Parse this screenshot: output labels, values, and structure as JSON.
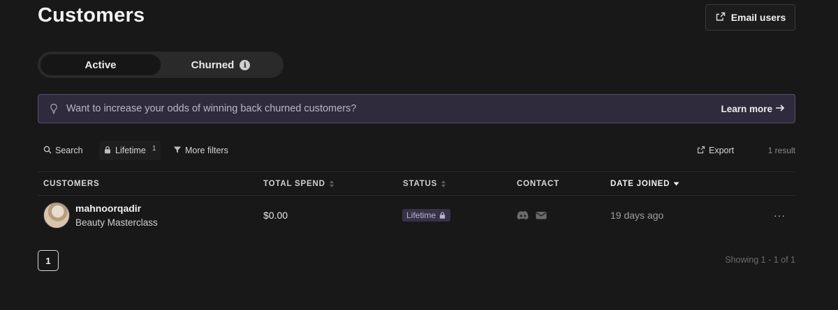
{
  "header": {
    "title": "Customers",
    "email_button_label": "Email users",
    "email_icon": "share-icon"
  },
  "tabs": [
    {
      "label": "Active",
      "selected": true
    },
    {
      "label": "Churned",
      "selected": false,
      "icon": "info-icon"
    }
  ],
  "banner": {
    "icon": "lightbulb-icon",
    "text": "Want to increase your odds of winning back churned customers?",
    "link_label": "Learn more"
  },
  "toolbar": {
    "search_label": "Search",
    "lifetime_label": "Lifetime",
    "lifetime_count": "1",
    "more_filters_label": "More filters",
    "export_label": "Export",
    "result_count": "1 result"
  },
  "table": {
    "columns": [
      {
        "label": "CUSTOMERS",
        "sortable": false
      },
      {
        "label": "TOTAL SPEND",
        "sortable": true
      },
      {
        "label": "STATUS",
        "sortable": true
      },
      {
        "label": "CONTACT",
        "sortable": false
      },
      {
        "label": "DATE JOINED",
        "sortable": true,
        "sorted": "desc"
      }
    ],
    "rows": [
      {
        "name": "mahnoorqadir",
        "product": "Beauty Masterclass",
        "total_spend": "$0.00",
        "status": "Lifetime",
        "contact_icons": [
          "discord-icon",
          "mail-icon"
        ],
        "date_joined": "19 days ago",
        "more_label": "···"
      }
    ]
  },
  "pagination": {
    "current_page": "1",
    "showing_text": "Showing 1 - 1 of 1"
  },
  "colors": {
    "background": "#181818",
    "banner_background": "#2f2b3d",
    "badge_background": "#373247"
  }
}
